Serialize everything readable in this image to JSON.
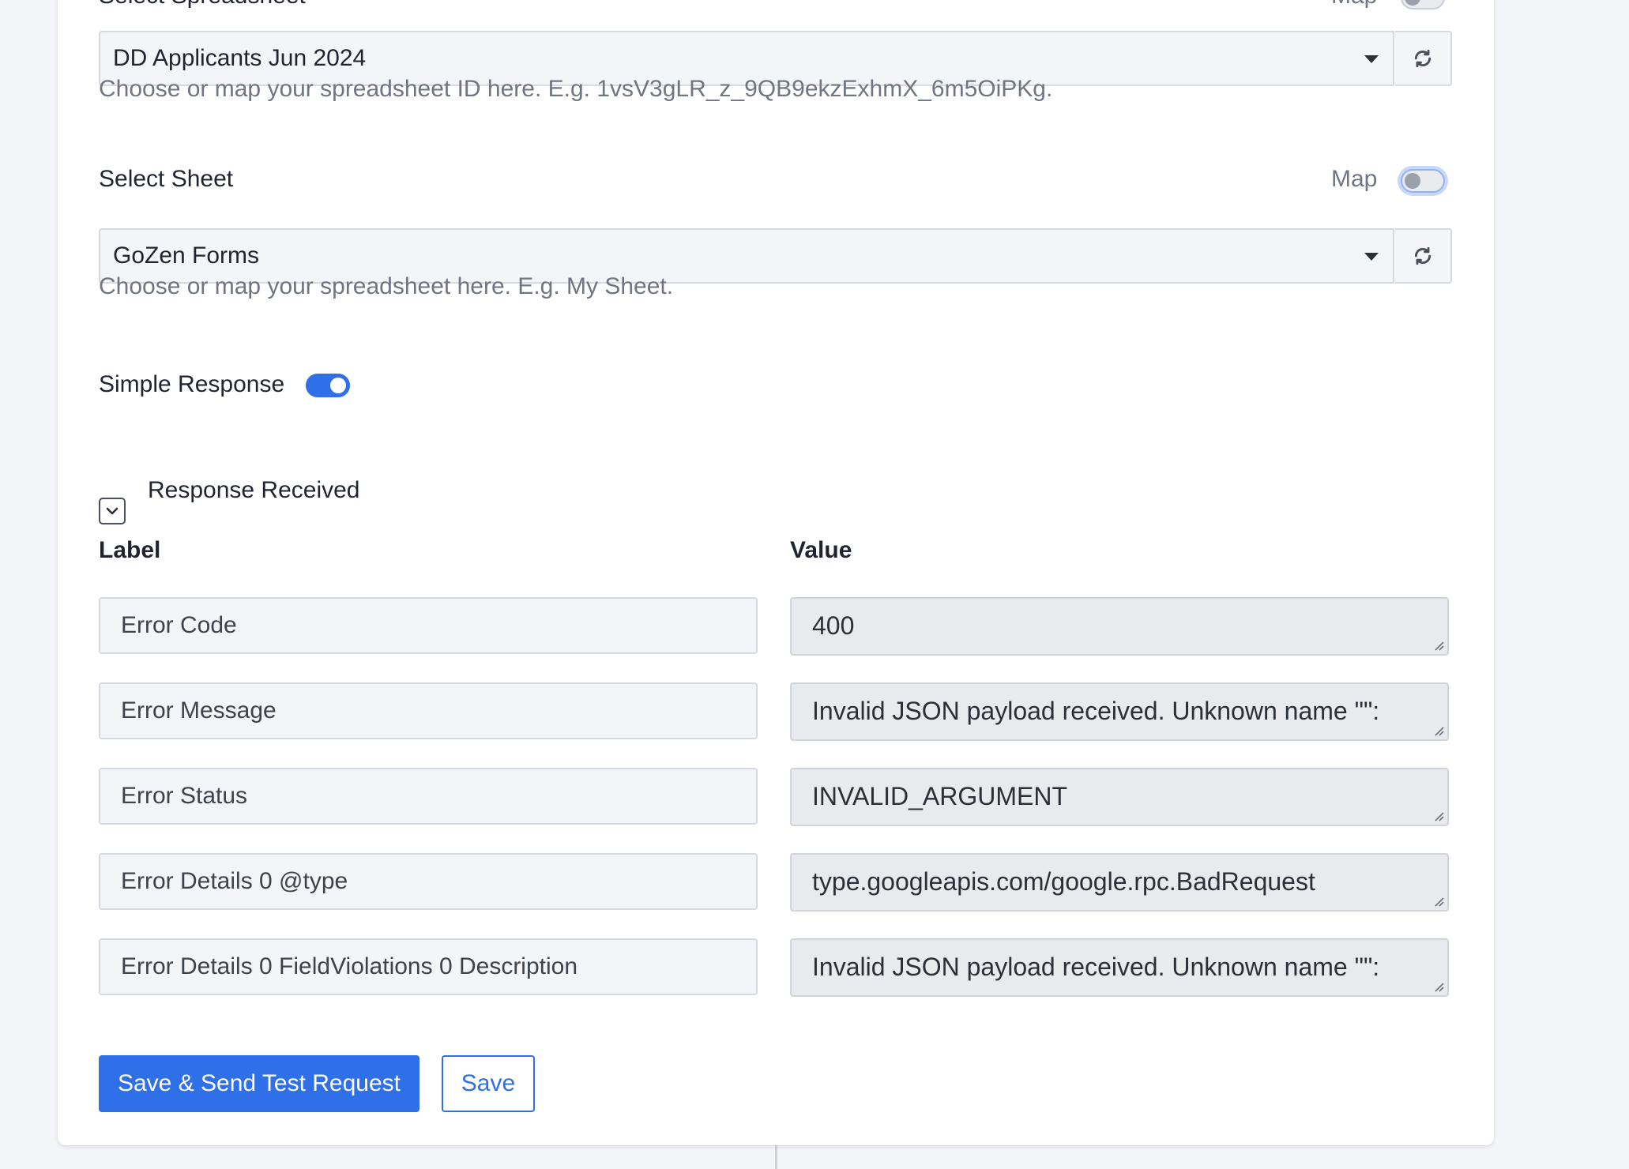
{
  "spreadsheet": {
    "label": "Select Spreadsheet",
    "map_label": "Map",
    "value": "DD Applicants Jun 2024",
    "hint": "Choose or map your spreadsheet ID here. E.g. 1vsV3gLR_z_9QB9ekzExhmX_6m5OiPKg."
  },
  "sheet": {
    "label": "Select Sheet",
    "map_label": "Map",
    "value": "GoZen Forms",
    "hint": "Choose or map your spreadsheet here. E.g. My Sheet."
  },
  "simple_response": {
    "label": "Simple Response",
    "enabled": true
  },
  "response": {
    "title": "Response Received",
    "label_header": "Label",
    "value_header": "Value",
    "rows": [
      {
        "label": "Error Code",
        "value": "400"
      },
      {
        "label": "Error Message",
        "value": "Invalid JSON payload received. Unknown name \"\":"
      },
      {
        "label": "Error Status",
        "value": "INVALID_ARGUMENT"
      },
      {
        "label": "Error Details 0 @type",
        "value": "type.googleapis.com/google.rpc.BadRequest"
      },
      {
        "label": "Error Details 0 FieldViolations 0 Description",
        "value": "Invalid JSON payload received. Unknown name \"\":"
      }
    ]
  },
  "actions": {
    "primary_label": "Save & Send Test Request",
    "secondary_label": "Save"
  },
  "icons": {
    "refresh": "refresh-icon",
    "dropdown": "caret-down-icon",
    "collapse": "chevron-down-icon",
    "resize": "resize-grip-icon"
  },
  "colors": {
    "accent": "#2f6fe8",
    "field_bg": "#f4f5f8",
    "value_bg": "#e9eaee",
    "hint_text": "#6f7682"
  }
}
